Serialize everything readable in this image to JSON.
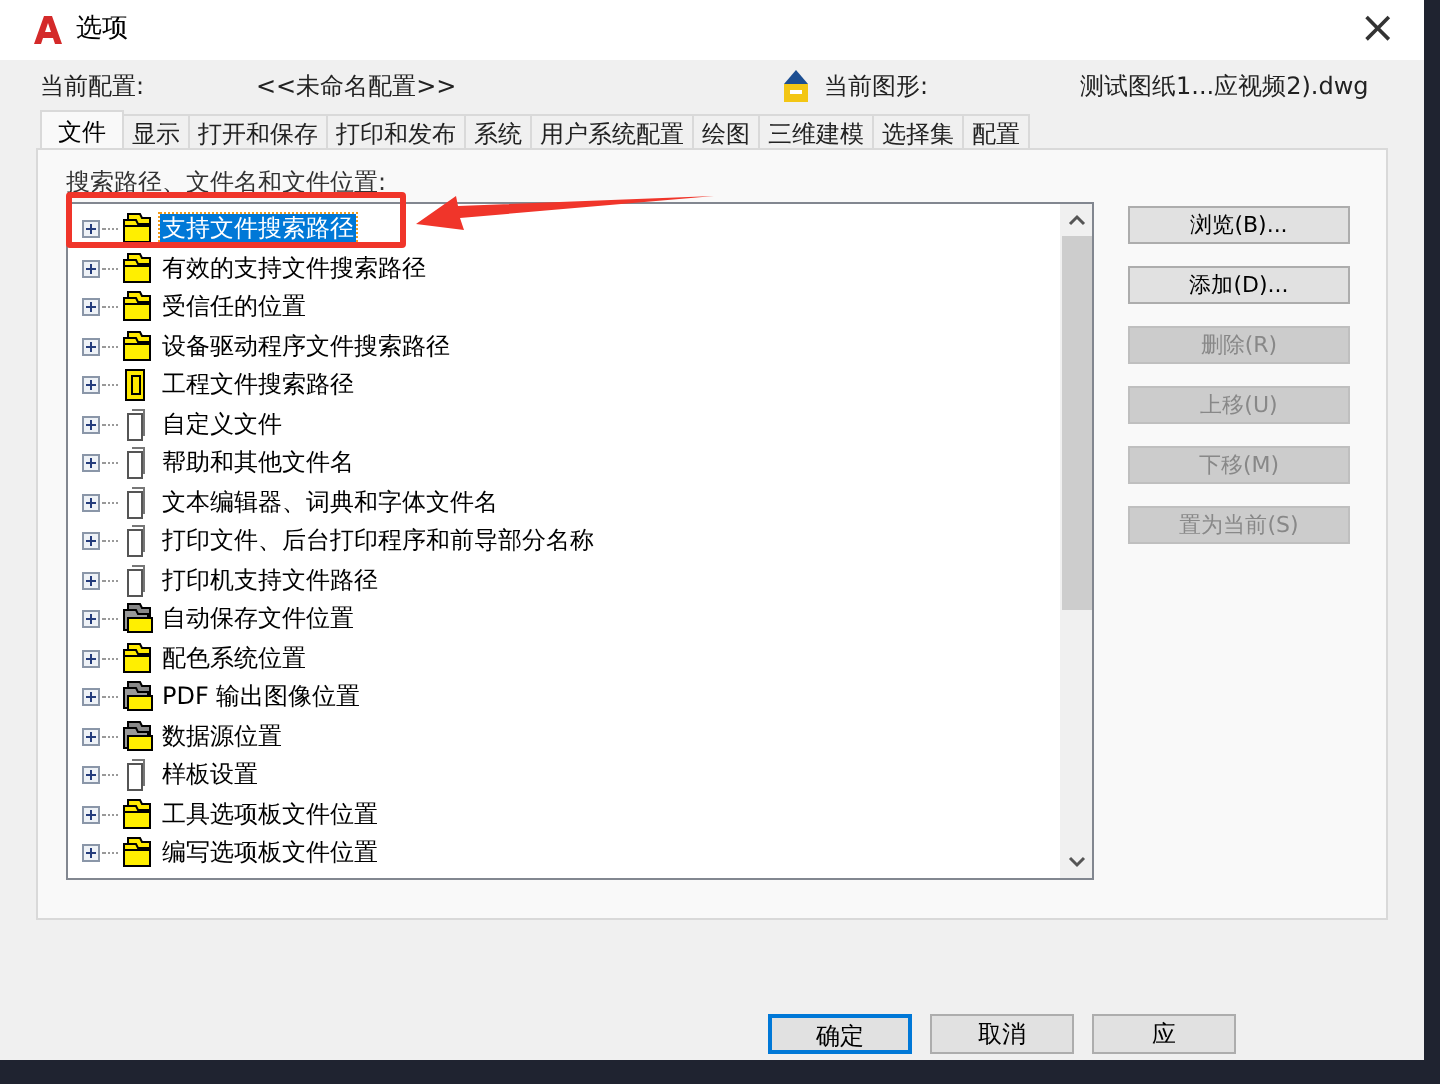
{
  "window": {
    "title": "选项",
    "close": "×"
  },
  "profile": {
    "label": "当前配置:",
    "value": "<<未命名配置>>",
    "drawing_label": "当前图形:",
    "drawing_value": "测试图纸1...应视频2).dwg"
  },
  "tabs": [
    {
      "label": "文件",
      "selected": true
    },
    {
      "label": "显示",
      "selected": false
    },
    {
      "label": "打开和保存",
      "selected": false
    },
    {
      "label": "打印和发布",
      "selected": false
    },
    {
      "label": "系统",
      "selected": false
    },
    {
      "label": "用户系统配置",
      "selected": false
    },
    {
      "label": "绘图",
      "selected": false
    },
    {
      "label": "三维建模",
      "selected": false
    },
    {
      "label": "选择集",
      "selected": false
    },
    {
      "label": "配置",
      "selected": false
    }
  ],
  "tree": {
    "label": "搜索路径、文件名和文件位置:",
    "items": [
      {
        "label": "支持文件搜索路径",
        "kind": "folders",
        "selected": true
      },
      {
        "label": "有效的支持文件搜索路径",
        "kind": "folders",
        "selected": false
      },
      {
        "label": "受信任的位置",
        "kind": "folders",
        "selected": false
      },
      {
        "label": "设备驱动程序文件搜索路径",
        "kind": "folders",
        "selected": false
      },
      {
        "label": "工程文件搜索路径",
        "kind": "project",
        "selected": false
      },
      {
        "label": "自定义文件",
        "kind": "file",
        "selected": false
      },
      {
        "label": "帮助和其他文件名",
        "kind": "file",
        "selected": false
      },
      {
        "label": "文本编辑器、词典和字体文件名",
        "kind": "file",
        "selected": false
      },
      {
        "label": "打印文件、后台打印程序和前导部分名称",
        "kind": "file",
        "selected": false
      },
      {
        "label": "打印机支持文件路径",
        "kind": "file",
        "selected": false
      },
      {
        "label": "自动保存文件位置",
        "kind": "gray-folders",
        "selected": false
      },
      {
        "label": "配色系统位置",
        "kind": "folders",
        "selected": false
      },
      {
        "label": "PDF 输出图像位置",
        "kind": "gray-folders",
        "selected": false
      },
      {
        "label": "数据源位置",
        "kind": "gray-folders",
        "selected": false
      },
      {
        "label": "样板设置",
        "kind": "file",
        "selected": false
      },
      {
        "label": "工具选项板文件位置",
        "kind": "folders",
        "selected": false
      },
      {
        "label": "编写选项板文件位置",
        "kind": "folders",
        "selected": false
      }
    ]
  },
  "side_buttons": [
    {
      "label": "浏览(B)...",
      "disabled": false
    },
    {
      "label": "添加(D)...",
      "disabled": false
    },
    {
      "label": "删除(R)",
      "disabled": true
    },
    {
      "label": "上移(U)",
      "disabled": true
    },
    {
      "label": "下移(M)",
      "disabled": true
    },
    {
      "label": "置为当前(S)",
      "disabled": true
    }
  ],
  "footer_buttons": [
    {
      "label": "确定",
      "selected": true
    },
    {
      "label": "取消",
      "selected": false
    },
    {
      "label": "应",
      "selected": false
    }
  ]
}
